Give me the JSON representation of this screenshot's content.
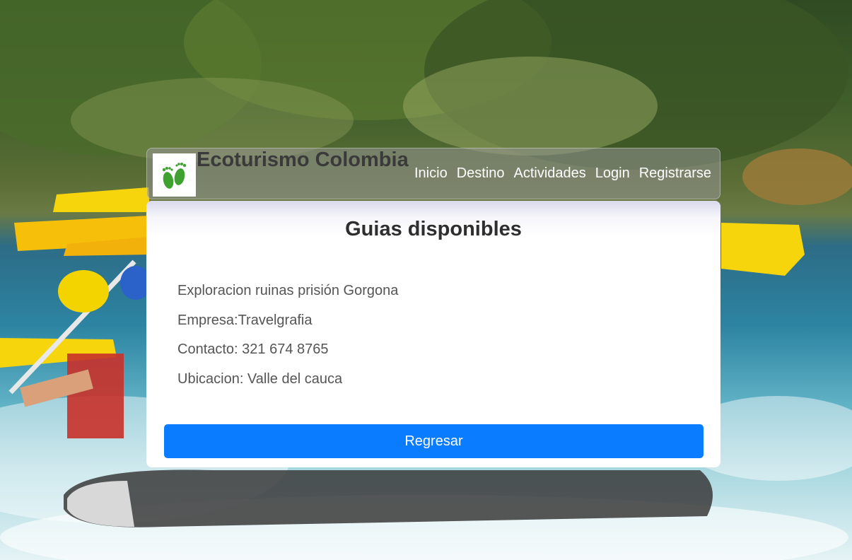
{
  "header": {
    "brand": "Ecoturismo Colombia",
    "logo_icon": "footprints-icon",
    "nav": [
      "Inicio",
      "Destino",
      "Actividades",
      "Login",
      "Registrarse"
    ]
  },
  "card": {
    "title": "Guias disponibles",
    "tour_name": "Exploracion ruinas prisión Gorgona",
    "company": "Empresa:Travelgrafia",
    "contact": "Contacto: 321 674 8765",
    "location": "Ubicacion: Valle del cauca",
    "back_button": "Regresar"
  },
  "colors": {
    "button": "#0a7cff",
    "logo_green": "#3fa12f"
  }
}
